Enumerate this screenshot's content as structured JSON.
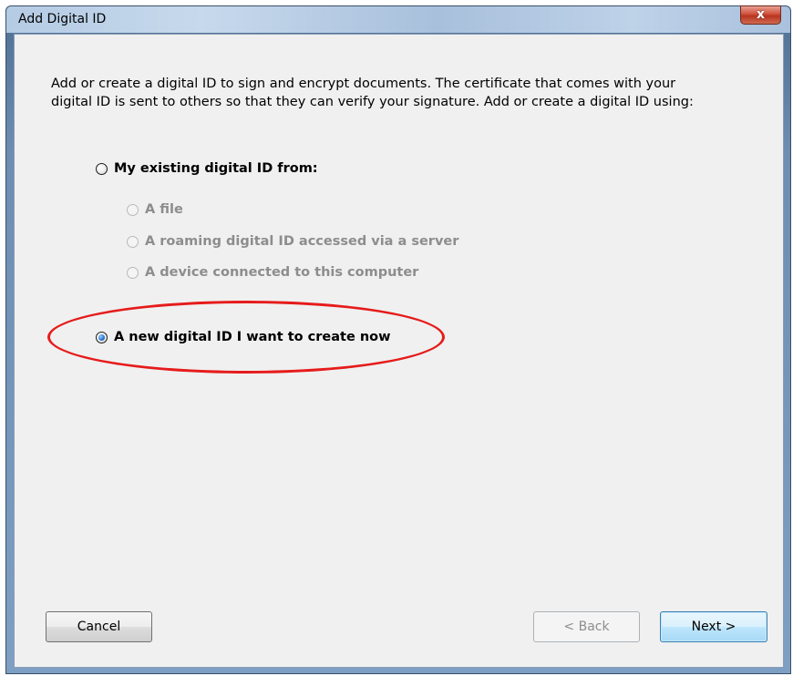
{
  "window": {
    "title": "Add Digital ID",
    "close_glyph": "x"
  },
  "intro": {
    "line1": "Add or create a digital ID to sign and encrypt documents. The certificate that comes with your",
    "line2": "digital ID is sent to others so that they can verify your signature. Add or create a digital ID using:"
  },
  "options": {
    "existing": {
      "label": "My existing digital ID from:",
      "checked": false,
      "enabled": true
    },
    "sub": [
      {
        "label": "A file",
        "enabled": false
      },
      {
        "label": "A roaming digital ID accessed via a server",
        "enabled": false
      },
      {
        "label": "A device connected to this computer",
        "enabled": false
      }
    ],
    "new": {
      "label": "A new digital ID I want to create now",
      "checked": true,
      "enabled": true
    }
  },
  "buttons": {
    "cancel": "Cancel",
    "back": "< Back",
    "next": "Next >"
  },
  "colors": {
    "highlight": "#e61b1b",
    "dialog_bg": "#f0f0f0",
    "disabled_text": "#8d8d8d"
  }
}
